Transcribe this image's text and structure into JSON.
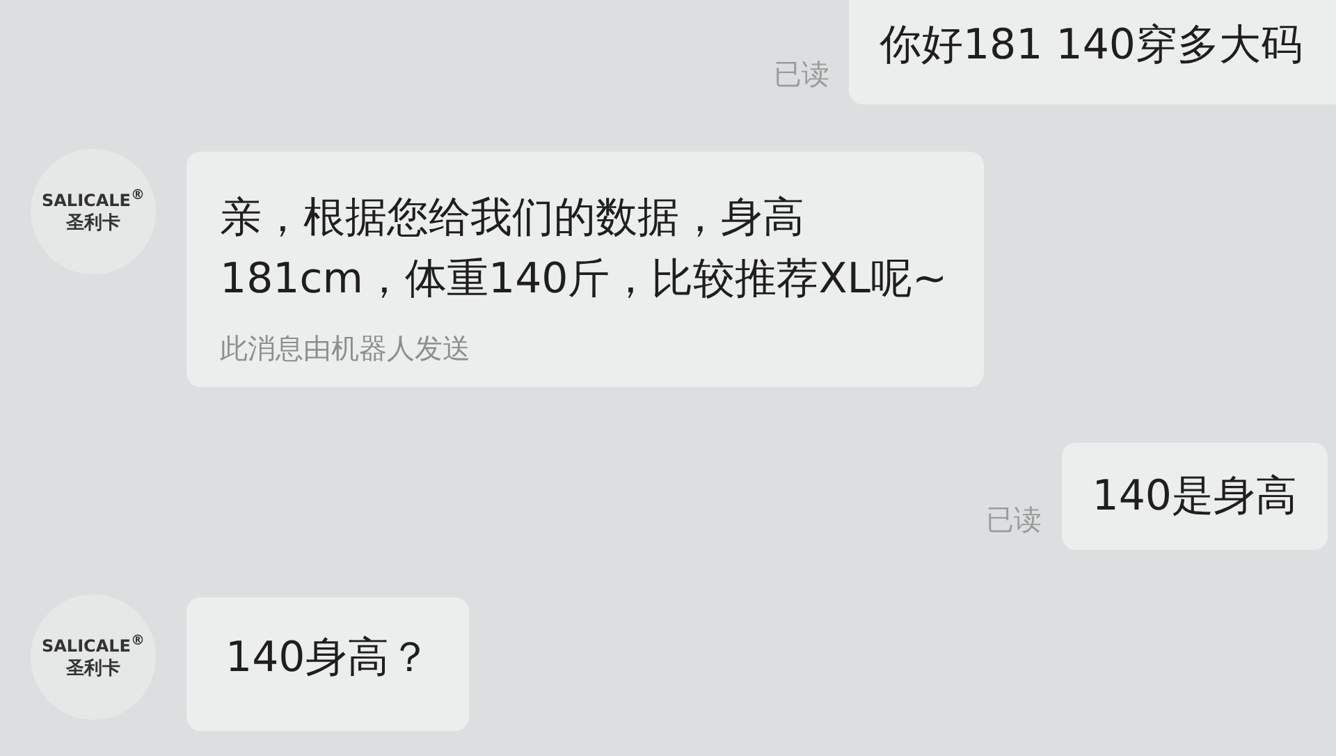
{
  "messages": [
    {
      "kind": "sent",
      "text": "你好181 140穿多大码",
      "status": "已读"
    },
    {
      "kind": "received",
      "avatar": {
        "brand": "SALICALE$^{®}$",
        "name": "圣利卡"
      },
      "lines": [
        "亲，根据您给我们的数据，身高",
        "181cm，体重140斤，比较推荐XL呢~"
      ],
      "note": "此消息由机器人发送"
    },
    {
      "kind": "sent",
      "text": "140是身高",
      "status": "已读"
    },
    {
      "kind": "received",
      "avatar": {
        "brand": "SALICALE$^{®}$",
        "name": "圣利卡"
      },
      "lines": [
        "140身高？"
      ]
    }
  ]
}
